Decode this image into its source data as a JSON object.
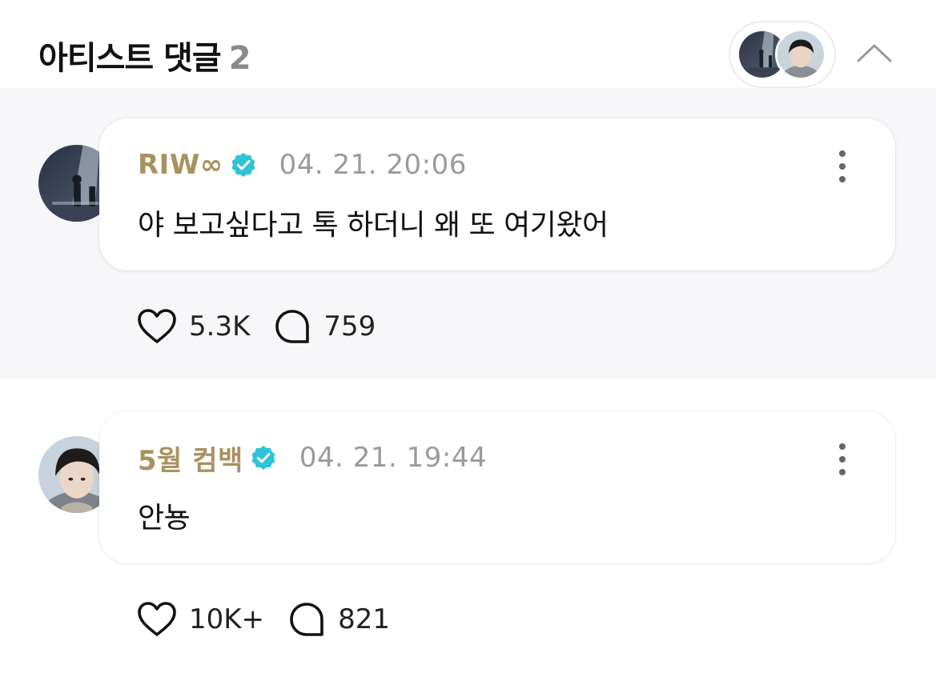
{
  "header": {
    "title": "아티스트 댓글",
    "count": "2"
  },
  "comments": [
    {
      "username": "RIW∞",
      "timestamp": "04. 21. 20:06",
      "text": "야 보고싶다고 톡 하더니 왜 또 여기왔어",
      "likes": "5.3K",
      "replies": "759"
    },
    {
      "username": "5월 컴백",
      "timestamp": "04. 21. 19:44",
      "text": "안뇽",
      "likes": "10K+",
      "replies": "821"
    }
  ],
  "icons": {
    "verified": "verified-badge-icon",
    "like": "heart-icon",
    "reply": "speech-bubble-icon",
    "more": "more-vertical-icon",
    "collapse": "chevron-up-icon"
  },
  "colors": {
    "username": "#a8925f",
    "verified": "#2ec3d6",
    "timestamp": "#9a9a9a",
    "count": "#8a8a8a",
    "section_bg": "#f7f7f9"
  }
}
